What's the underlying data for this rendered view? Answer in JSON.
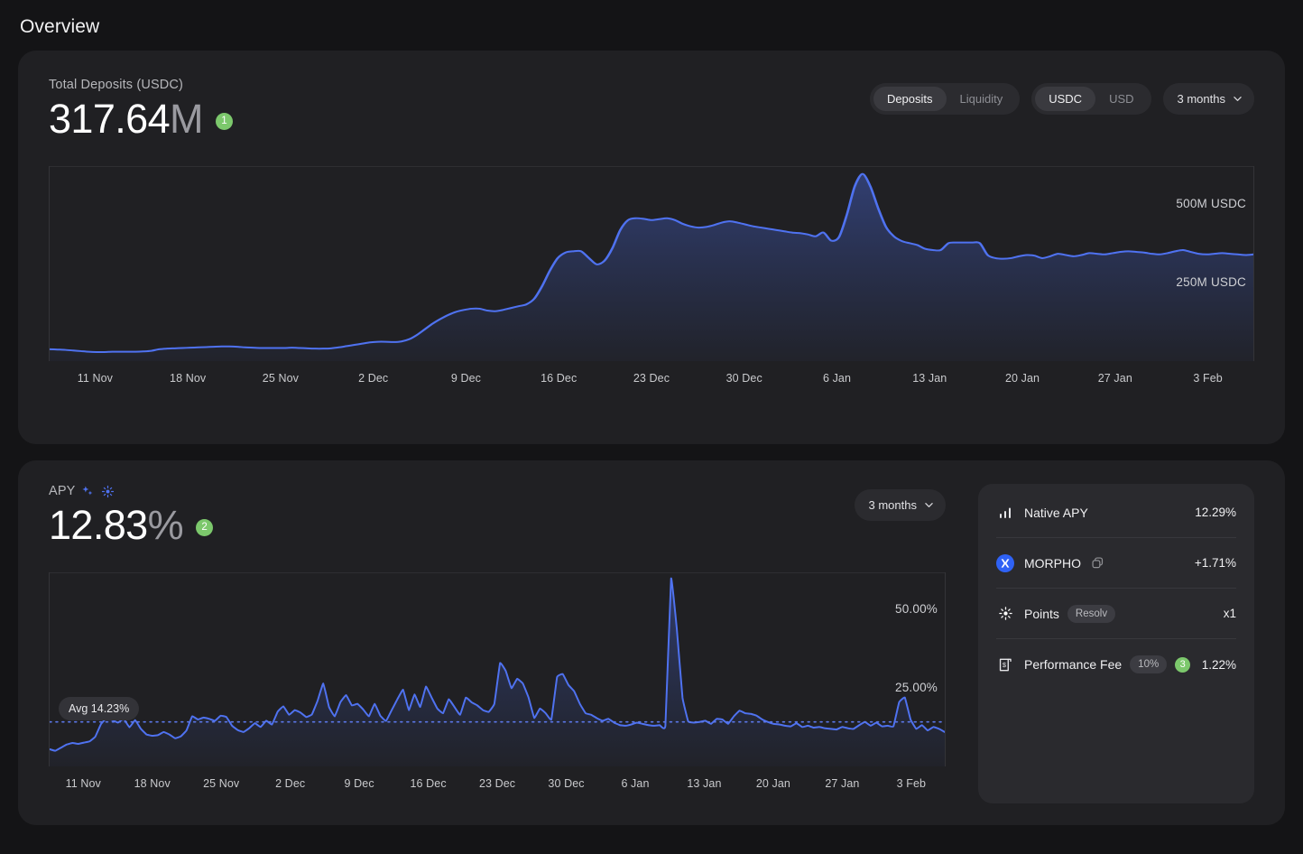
{
  "page": {
    "title": "Overview"
  },
  "deposits_card": {
    "label": "Total Deposits (USDC)",
    "value": "317.64",
    "unit": "M",
    "badge": "1",
    "controls": {
      "mode": {
        "options": [
          "Deposits",
          "Liquidity"
        ],
        "selected": "Deposits"
      },
      "currency": {
        "options": [
          "USDC",
          "USD"
        ],
        "selected": "USDC"
      },
      "range": {
        "selected": "3 months"
      }
    },
    "gridlines": [
      "500M USDC",
      "250M USDC"
    ]
  },
  "apy_card": {
    "label": "APY",
    "value": "12.83",
    "unit": "%",
    "badge": "2",
    "controls": {
      "range": {
        "selected": "3 months"
      }
    },
    "avg_label": "Avg 14.23%",
    "gridlines": [
      "50.00%",
      "25.00%"
    ],
    "breakdown": [
      {
        "icon": "bar-chart-icon",
        "name": "Native APY",
        "value": "12.29%"
      },
      {
        "icon": "morpho-logo-icon",
        "name": "MORPHO",
        "value": "+1.71%",
        "copy": true
      },
      {
        "icon": "sparkle-icon",
        "name": "Points",
        "tag": "Resolv",
        "value": "x1"
      },
      {
        "icon": "receipt-icon",
        "name": "Performance Fee",
        "tag": "10%",
        "badge": "3",
        "value": "1.22%"
      }
    ]
  },
  "chart_data": [
    {
      "type": "area",
      "title": "Total Deposits (USDC)",
      "xlabel": "",
      "ylabel": "USDC",
      "ylim": [
        0,
        625
      ],
      "gridvalues": [
        500,
        250
      ],
      "gridlabels": [
        "500M USDC",
        "250M USDC"
      ],
      "categories": [
        "11 Nov",
        "18 Nov",
        "25 Nov",
        "2 Dec",
        "9 Dec",
        "16 Dec",
        "23 Dec",
        "30 Dec",
        "6 Jan",
        "13 Jan",
        "20 Jan",
        "27 Jan",
        "3 Feb"
      ],
      "units": "millions USDC",
      "values": [
        38,
        37,
        36,
        34,
        32,
        30,
        29,
        29,
        30,
        30,
        30,
        30,
        31,
        33,
        38,
        40,
        41,
        42,
        43,
        44,
        45,
        46,
        47,
        47,
        46,
        44,
        43,
        42,
        42,
        42,
        42,
        43,
        42,
        41,
        40,
        40,
        41,
        44,
        48,
        52,
        56,
        60,
        62,
        62,
        61,
        63,
        70,
        84,
        102,
        120,
        135,
        148,
        158,
        164,
        168,
        168,
        162,
        160,
        164,
        170,
        176,
        182,
        200,
        240,
        290,
        330,
        348,
        352,
        352,
        330,
        310,
        322,
        362,
        420,
        452,
        458,
        456,
        452,
        455,
        458,
        452,
        440,
        432,
        428,
        430,
        436,
        444,
        448,
        444,
        438,
        432,
        428,
        424,
        420,
        416,
        412,
        410,
        406,
        400,
        412,
        386,
        398,
        470,
        560,
        600,
        560,
        490,
        430,
        400,
        385,
        378,
        372,
        360,
        356,
        356,
        378,
        380,
        380,
        380,
        378,
        340,
        330,
        328,
        330,
        336,
        340,
        338,
        330,
        336,
        344,
        340,
        336,
        340,
        346,
        344,
        342,
        346,
        350,
        352,
        350,
        348,
        344,
        342,
        346,
        352,
        356,
        350,
        344,
        342,
        344,
        346,
        344,
        342,
        340,
        342
      ]
    },
    {
      "type": "area",
      "title": "APY",
      "xlabel": "",
      "ylabel": "%",
      "ylim": [
        0,
        62
      ],
      "gridvalues": [
        50,
        25
      ],
      "gridlabels": [
        "50.00%",
        "25.00%"
      ],
      "average": 14.23,
      "average_label": "Avg 14.23%",
      "categories": [
        "11 Nov",
        "18 Nov",
        "25 Nov",
        "2 Dec",
        "9 Dec",
        "16 Dec",
        "23 Dec",
        "30 Dec",
        "6 Jan",
        "13 Jan",
        "20 Jan",
        "27 Jan",
        "3 Feb"
      ],
      "units": "percent",
      "values": [
        5.5,
        5.0,
        6.0,
        7.0,
        7.5,
        7.2,
        7.6,
        8.0,
        9.5,
        13.5,
        15.5,
        14.8,
        14.0,
        15.2,
        12.5,
        14.8,
        12.0,
        10.2,
        9.8,
        10.0,
        11.0,
        10.2,
        9.0,
        9.6,
        11.5,
        16.0,
        15.0,
        15.6,
        15.2,
        14.6,
        16.2,
        15.8,
        13.0,
        11.6,
        11.0,
        12.2,
        13.8,
        12.6,
        14.6,
        13.4,
        17.5,
        19.2,
        16.5,
        18.0,
        17.2,
        15.8,
        16.6,
        21.0,
        26.5,
        19.0,
        16.0,
        20.5,
        22.8,
        19.5,
        20.0,
        18.2,
        16.0,
        20.0,
        16.2,
        14.5,
        18.0,
        21.5,
        24.5,
        18.0,
        23.0,
        19.0,
        25.5,
        22.0,
        18.5,
        17.0,
        21.5,
        19.0,
        16.5,
        22.0,
        20.5,
        19.5,
        18.0,
        17.4,
        20.0,
        33.0,
        30.5,
        25.0,
        28.0,
        26.5,
        22.0,
        15.5,
        18.5,
        17.0,
        15.0,
        28.5,
        29.5,
        26.0,
        24.0,
        20.0,
        17.0,
        16.5,
        15.4,
        14.6,
        15.2,
        14.0,
        13.2,
        13.0,
        13.4,
        14.0,
        13.6,
        13.2,
        13.0,
        13.2,
        13.0,
        60.0,
        44.0,
        22.0,
        14.4,
        14.0,
        14.2,
        14.6,
        13.6,
        15.2,
        15.0,
        13.6,
        16.0,
        17.8,
        17.0,
        16.8,
        16.2,
        15.0,
        14.2,
        13.6,
        13.4,
        13.0,
        12.8,
        13.8,
        12.6,
        13.0,
        12.4,
        12.6,
        12.2,
        12.0,
        11.8,
        12.6,
        12.2,
        12.0,
        13.2,
        14.2,
        13.0,
        14.0,
        12.8,
        13.0,
        12.8,
        20.5,
        22.0,
        15.0,
        12.0,
        13.2,
        11.5,
        12.6,
        12.0,
        11.0
      ]
    }
  ]
}
